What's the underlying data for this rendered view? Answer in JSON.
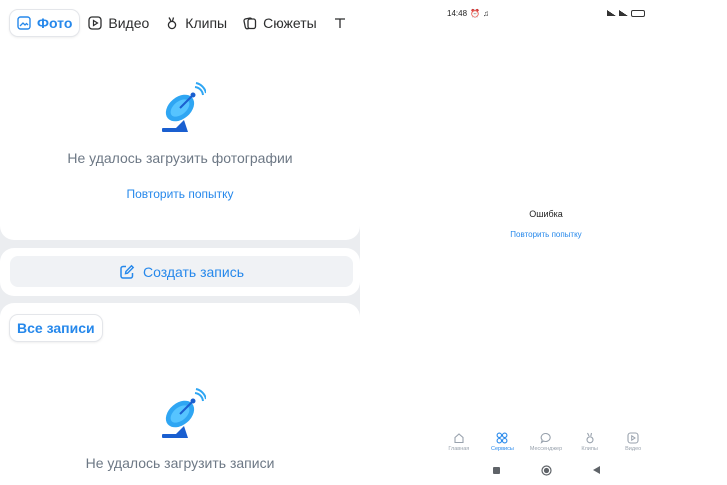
{
  "left": {
    "tabs": [
      {
        "label": "Фото",
        "icon": "photo-icon",
        "active": true
      },
      {
        "label": "Видео",
        "icon": "video-icon",
        "active": false
      },
      {
        "label": "Клипы",
        "icon": "clips-icon",
        "active": false
      },
      {
        "label": "Сюжеты",
        "icon": "stories-icon",
        "active": false
      }
    ],
    "photos_error": "Не удалось загрузить фотографии",
    "photos_retry": "Повторить попытку",
    "create_post": "Создать запись",
    "all_posts": "Все записи",
    "posts_error": "Не удалось загрузить записи"
  },
  "phone": {
    "status": {
      "time": "14:48"
    },
    "error_title": "Ошибка",
    "retry": "Повторить попытку",
    "nav": [
      {
        "label": "Главная",
        "icon": "home-icon",
        "active": false
      },
      {
        "label": "Сервисы",
        "icon": "services-icon",
        "active": true
      },
      {
        "label": "Мессенджер",
        "icon": "messenger-icon",
        "active": false
      },
      {
        "label": "Клипы",
        "icon": "clips-icon",
        "active": false
      },
      {
        "label": "Видео",
        "icon": "video-icon",
        "active": false
      }
    ]
  },
  "colors": {
    "accent": "#2688eb",
    "muted": "#6d7885",
    "bg": "#ebedf0"
  }
}
